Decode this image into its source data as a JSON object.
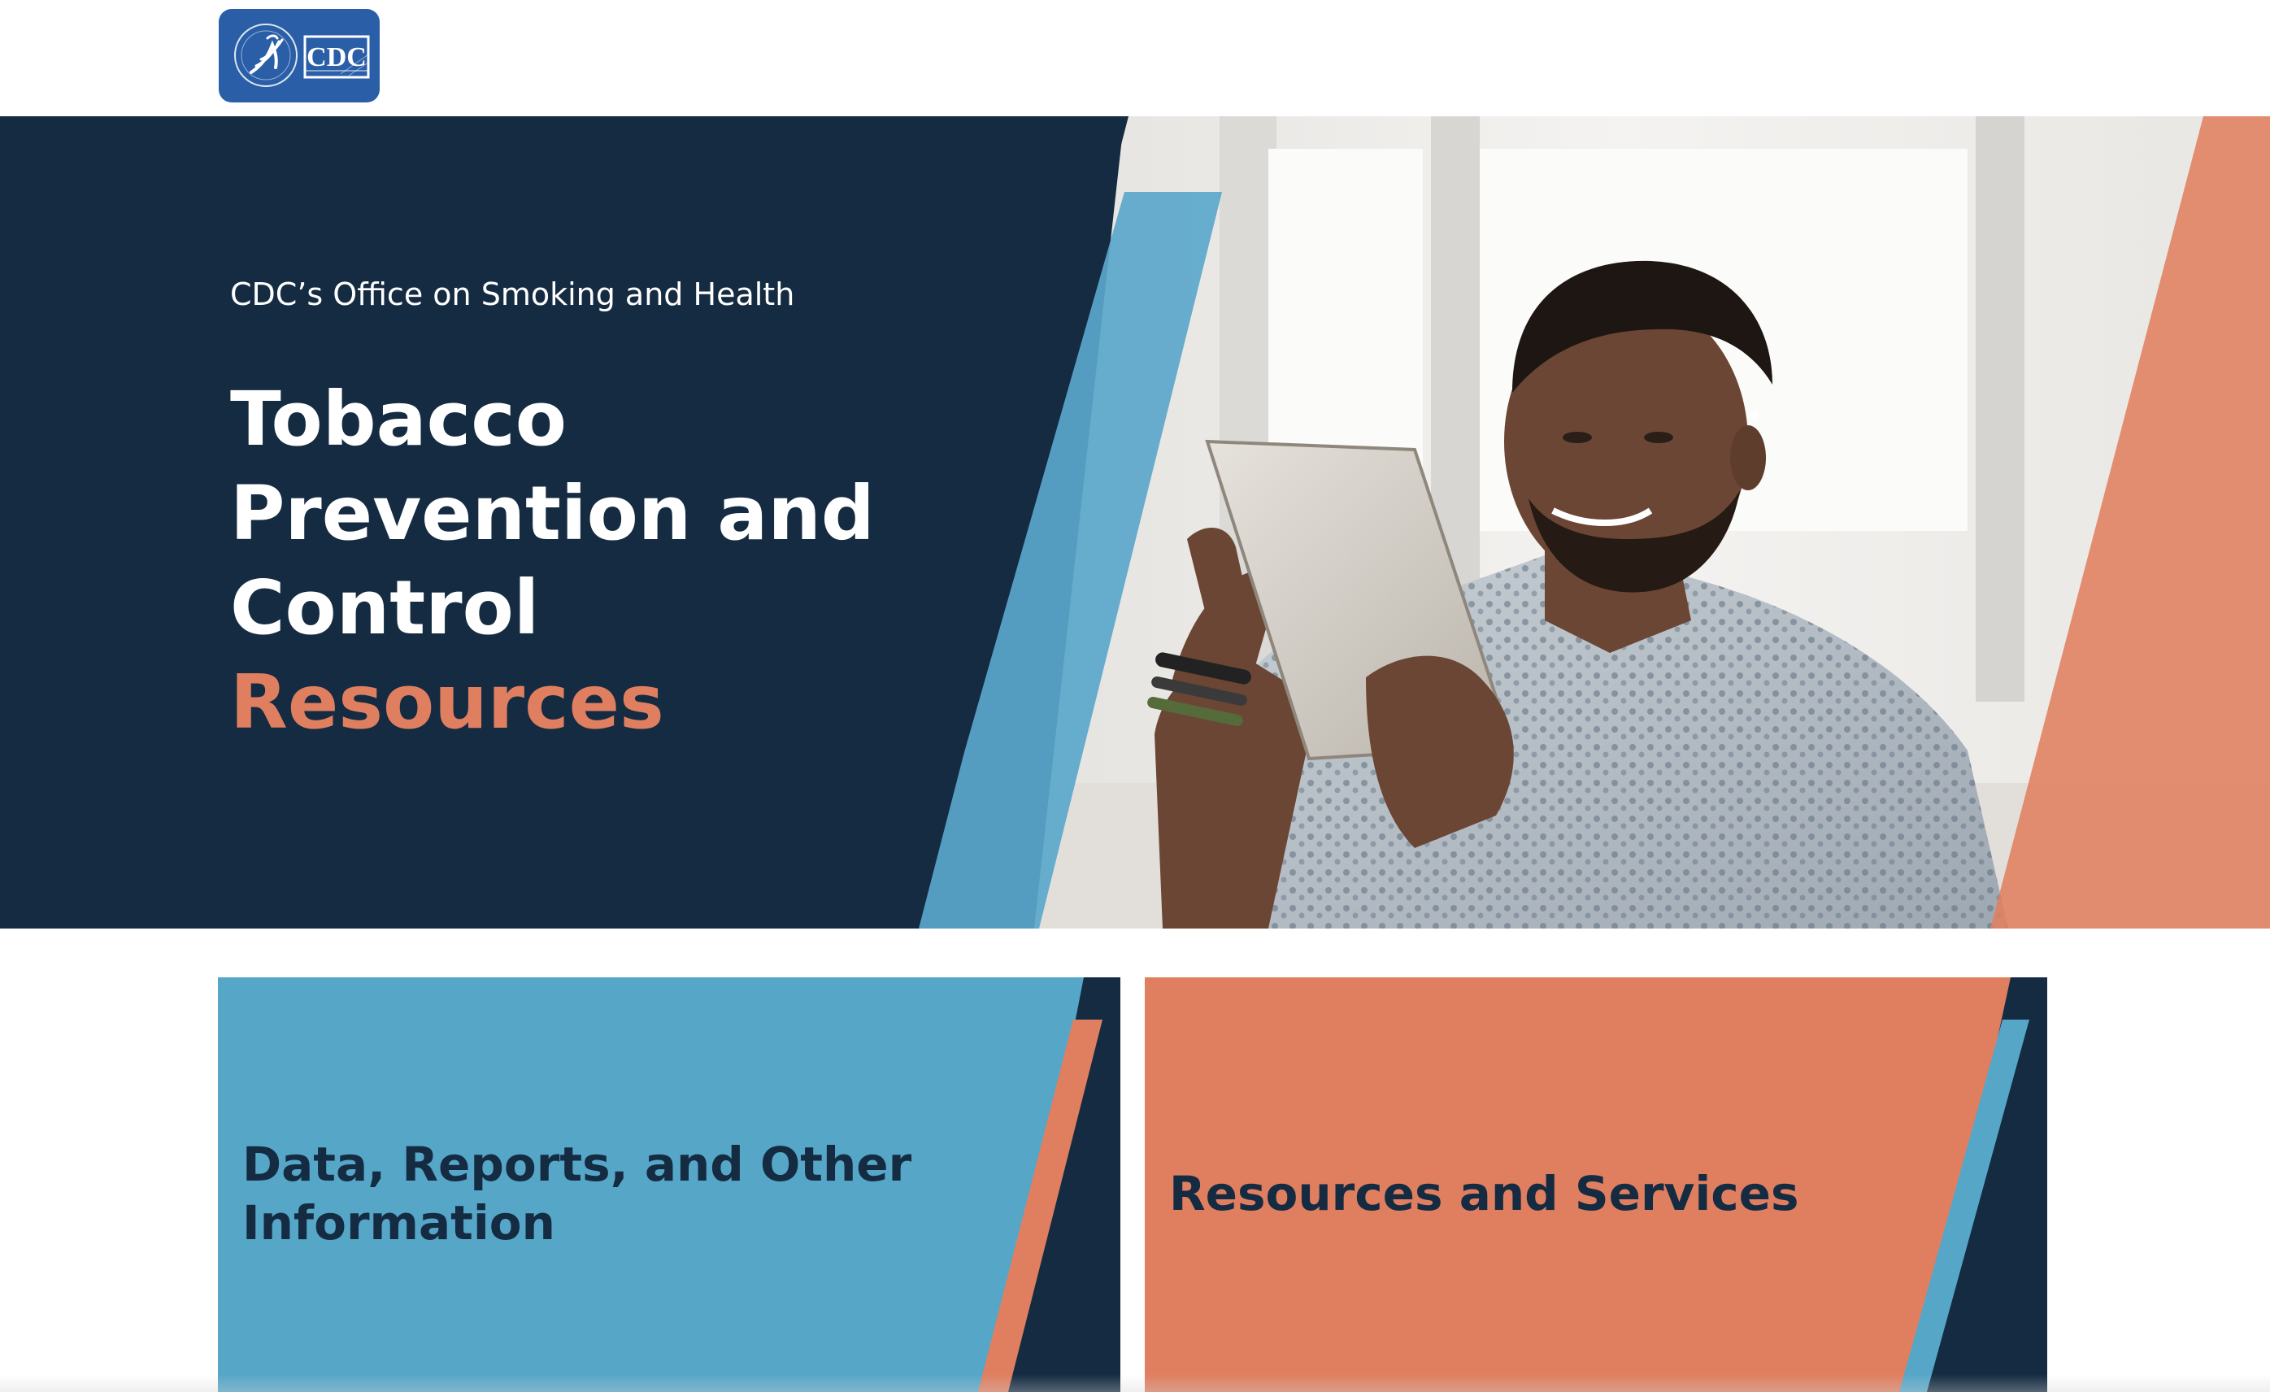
{
  "header": {
    "logo_text": "CDC",
    "logo_icon": "hhs-eagle-icon"
  },
  "hero": {
    "subtitle": "CDC’s Office on Smoking and Health",
    "title_lines": [
      "Tobacco",
      "Prevention and",
      "Control"
    ],
    "title_accent": "Resources",
    "photo_description_icon": "man-with-tablet-photo"
  },
  "cards": [
    {
      "title": "Data, Reports, and Other Information"
    },
    {
      "title": "Resources and Services"
    }
  ],
  "colors": {
    "navy": "#152b42",
    "blue": "#5ba7cb",
    "coral": "#e07f60",
    "logo_blue": "#2a5fa8"
  }
}
